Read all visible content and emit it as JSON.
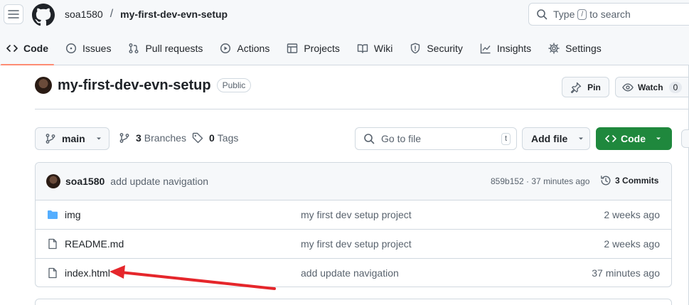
{
  "header": {
    "owner": "soa1580",
    "separator": "/",
    "repo": "my-first-dev-evn-setup",
    "search": {
      "prefix": "Type",
      "key": "/",
      "suffix": "to search"
    }
  },
  "tabs": [
    {
      "label": "Code",
      "icon": "code-icon",
      "active": true
    },
    {
      "label": "Issues",
      "icon": "issue-opened-icon"
    },
    {
      "label": "Pull requests",
      "icon": "git-pull-request-icon"
    },
    {
      "label": "Actions",
      "icon": "play-icon"
    },
    {
      "label": "Projects",
      "icon": "table-icon"
    },
    {
      "label": "Wiki",
      "icon": "book-icon"
    },
    {
      "label": "Security",
      "icon": "shield-icon"
    },
    {
      "label": "Insights",
      "icon": "graph-icon"
    },
    {
      "label": "Settings",
      "icon": "gear-icon"
    }
  ],
  "repo_header": {
    "title": "my-first-dev-evn-setup",
    "visibility": "Public",
    "pin_label": "Pin",
    "watch_label": "Watch",
    "watch_count": "0"
  },
  "branch_bar": {
    "branch": "main",
    "branches_count": "3",
    "branches_label": "Branches",
    "tags_count": "0",
    "tags_label": "Tags",
    "goto_placeholder": "Go to file",
    "goto_key": "t",
    "add_file_label": "Add file",
    "code_label": "Code"
  },
  "latest_commit": {
    "author": "soa1580",
    "message": "add update navigation",
    "meta": "859b152 · 37 minutes ago",
    "commits_count": "3",
    "commits_label": "Commits"
  },
  "files": [
    {
      "name": "img",
      "type": "folder",
      "message": "my first dev setup project",
      "date": "2 weeks ago"
    },
    {
      "name": "README.md",
      "type": "file",
      "message": "my first dev setup project",
      "date": "2 weeks ago"
    },
    {
      "name": "index.html",
      "type": "file",
      "message": "add update navigation",
      "date": "37 minutes ago"
    }
  ],
  "colors": {
    "accent_green": "#1f883d",
    "folder_blue": "#54aeff",
    "tab_underline": "#fd8c73",
    "annotation_arrow": "#e5262b"
  }
}
